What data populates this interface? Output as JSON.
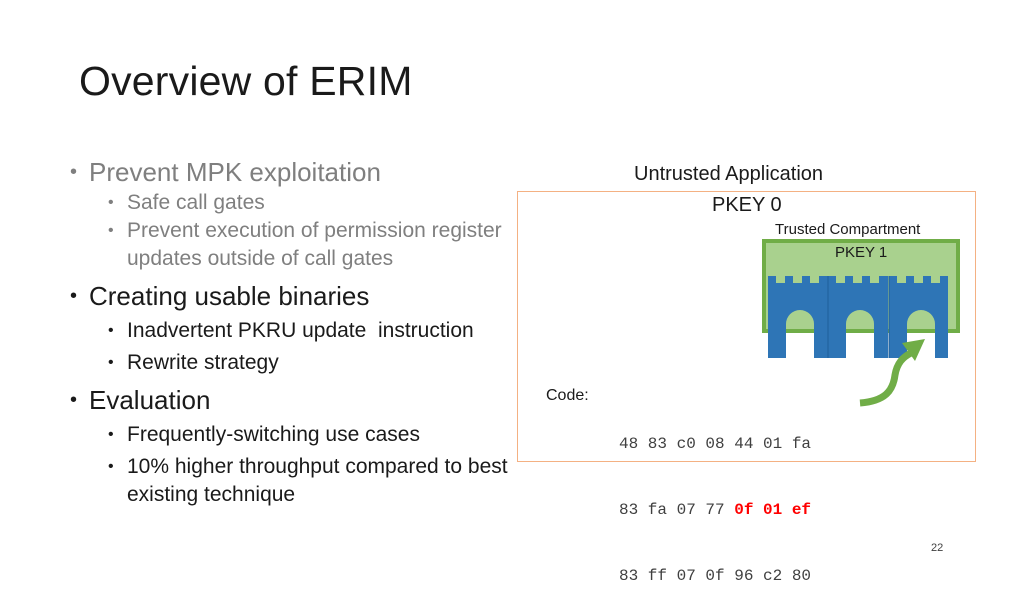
{
  "slide": {
    "title": "Overview of ERIM",
    "page_number": "22"
  },
  "bullets": [
    {
      "text": "Prevent MPK exploitation",
      "style": "muted",
      "children": [
        "Safe call gates",
        "Prevent execution of permission register updates outside of call gates"
      ]
    },
    {
      "text": "Creating usable binaries",
      "style": "normal",
      "children": [
        "Inadvertent PKRU update  instruction",
        "Rewrite strategy"
      ]
    },
    {
      "text": "Evaluation",
      "style": "normal",
      "children": [
        "Frequently-switching use cases",
        "10% higher throughput compared to best existing technique"
      ]
    }
  ],
  "diagram": {
    "outer_title": "Untrusted Application",
    "outer_key": "PKEY 0",
    "inner_title": "Trusted Compartment",
    "inner_key": "PKEY 1",
    "code_label": "Code:",
    "code_lines": [
      [
        {
          "t": "48 83 c0 08 44 01 fa",
          "hl": false
        }
      ],
      [
        {
          "t": "83 fa 07 77 ",
          "hl": false
        },
        {
          "t": "0f 01 ef",
          "hl": true
        }
      ],
      [
        {
          "t": "83 ff 07 0f 96 c2 80",
          "hl": false
        }
      ]
    ],
    "colors": {
      "outer_border": "#f4b183",
      "inner_fill": "#a9d18e",
      "inner_border": "#70ad47",
      "gate_fill": "#2e75b6",
      "arrow": "#70ad47",
      "highlight": "#ff0000"
    }
  }
}
